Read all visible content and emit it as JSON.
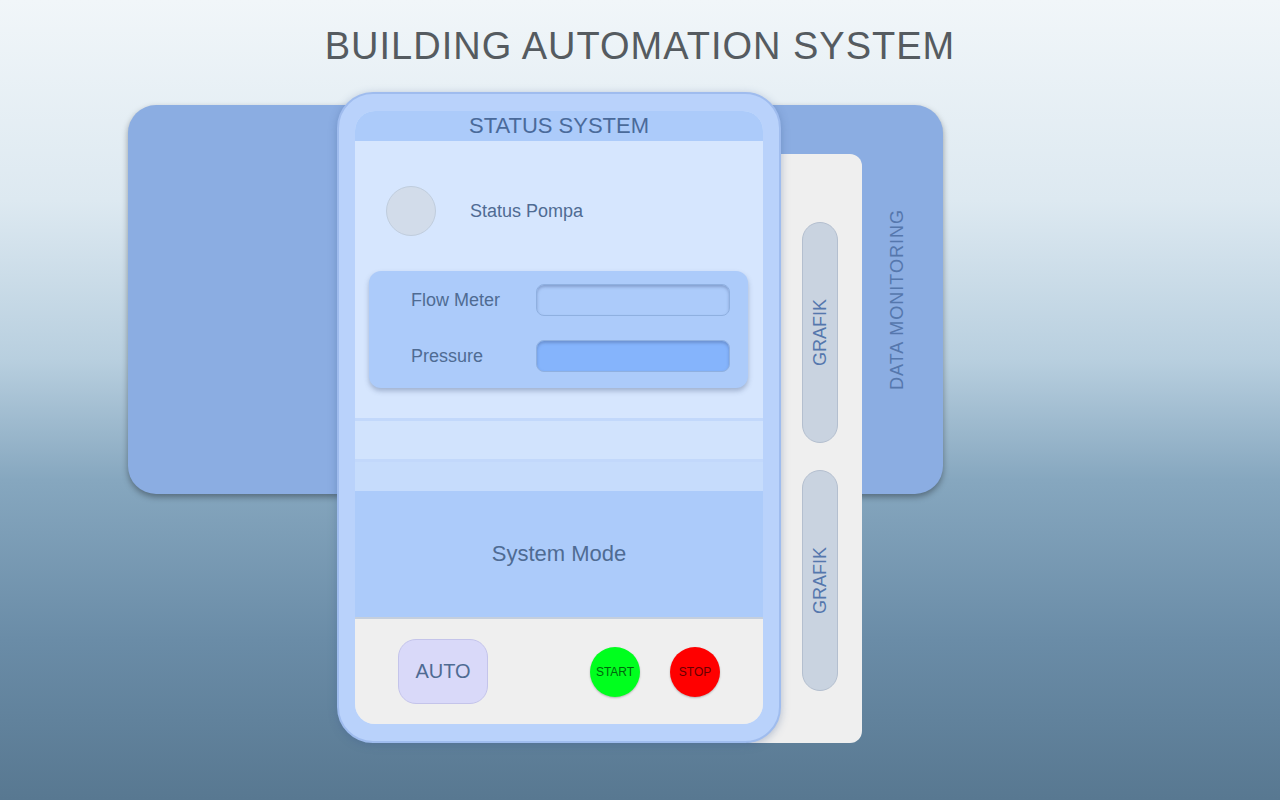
{
  "title": "BUILDING AUTOMATION SYSTEM",
  "monitoring_panel": {
    "title": "DATA MONITORING",
    "charts": [
      {
        "label": "GRAFIK"
      },
      {
        "label": "GRAFIK"
      }
    ]
  },
  "status_panel": {
    "title": "STATUS SYSTEM",
    "pump": {
      "label": "Status Pompa",
      "on": false
    },
    "readings": [
      {
        "label": "Flow Meter",
        "focused": false
      },
      {
        "label": "Pressure",
        "focused": true
      }
    ],
    "mode_title": "System Mode",
    "mode_button": {
      "label": "AUTO",
      "selected": false
    },
    "buttons": [
      {
        "label": "START",
        "color": "#00ff1e"
      },
      {
        "label": "STOP",
        "color": "#ff0000"
      }
    ]
  }
}
